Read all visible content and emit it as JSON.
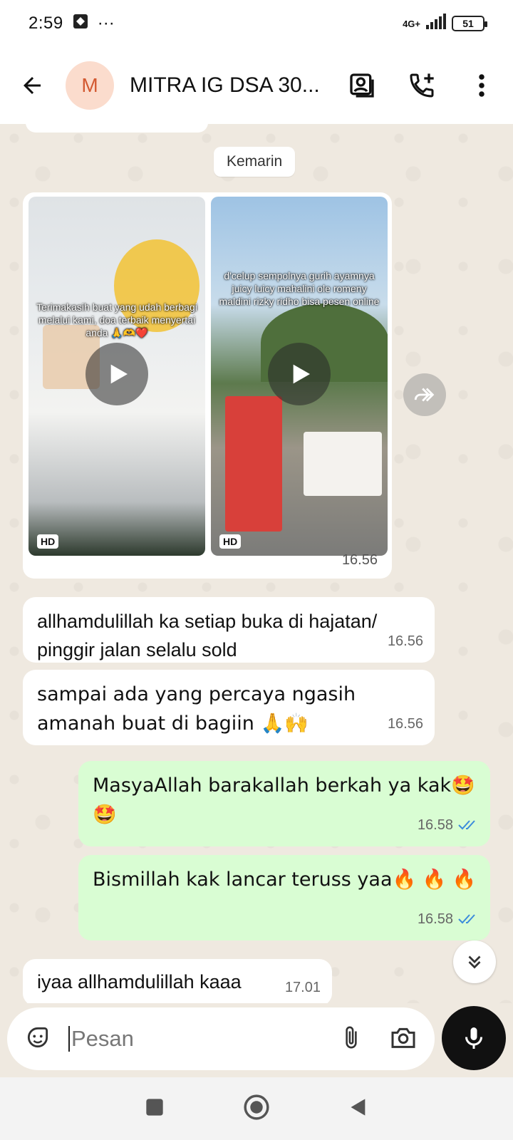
{
  "status_bar": {
    "time": "2:59",
    "more": "···",
    "network": "4G+",
    "battery": "51"
  },
  "header": {
    "avatar_letter": "M",
    "title": "MITRA IG DSA 30..."
  },
  "chat": {
    "date_chip": "Kemarin",
    "media": {
      "video1_caption": "Terimakasih buat yang udah berbagi melalui kami, doa terbaik menyertai anda 🙏🫶❤️",
      "video2_caption": "d'celup sempolnya gurih ayamnya juicy luicy mahalini ole romeny maldini rizky ridho bisa pesen online",
      "hd_label": "HD",
      "time": "16.56"
    },
    "messages": [
      {
        "text": "allhamdulillah ka setiap buka di hajatan/ pinggir jalan selalu sold",
        "time": "16.56"
      },
      {
        "text": "sampai ada yang percaya ngasih amanah buat di bagiin 🙏🙌",
        "time": "16.56"
      },
      {
        "text": "MasyaAllah barakallah berkah ya kak🤩 🤩",
        "time": "16.58"
      },
      {
        "text": "Bismillah kak lancar teruss yaa🔥 🔥 🔥",
        "time": "16.58"
      },
      {
        "text": "iyaa allhamdulillah kaaa",
        "time": "17.01"
      }
    ]
  },
  "composer": {
    "placeholder": "Pesan"
  },
  "colors": {
    "outgoing_bubble": "#d9fdd3",
    "incoming_bubble": "#ffffff",
    "chat_background": "#efe9e0",
    "read_ticks": "#3b8bdc",
    "avatar_bg": "#fbdccd"
  }
}
